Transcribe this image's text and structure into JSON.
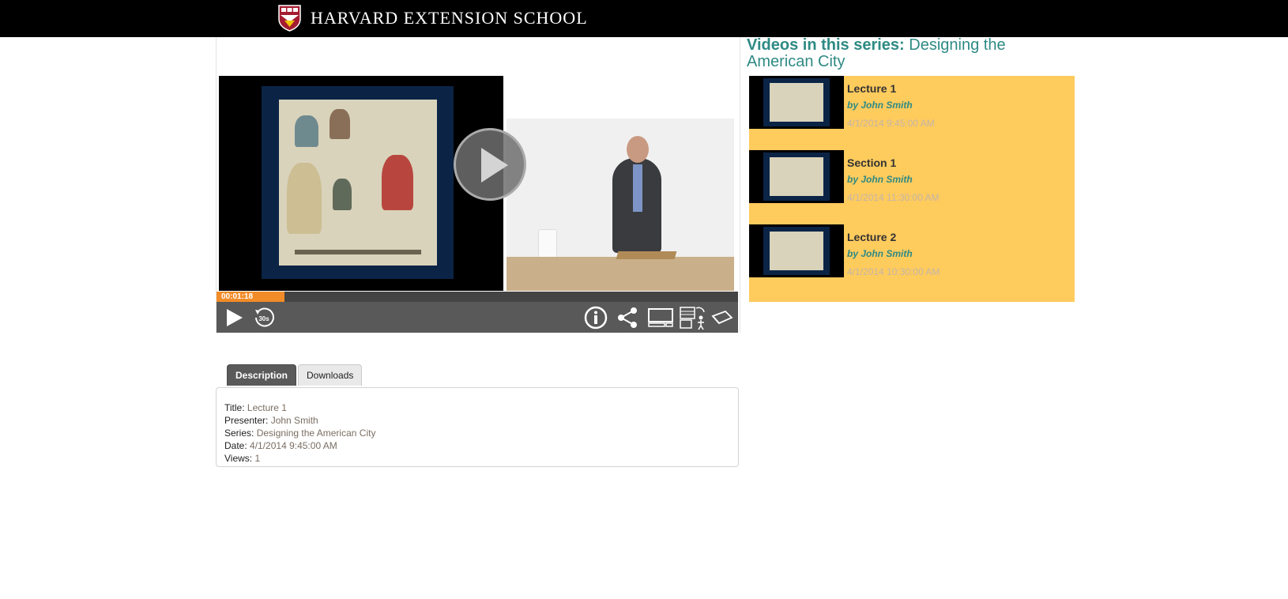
{
  "header": {
    "brand": "HARVARD EXTENSION SCHOOL"
  },
  "player": {
    "current_time": "00:01:18",
    "progress_fraction": 0.13,
    "controls": {
      "play": "play-icon",
      "rewind": "30s",
      "info": "info-icon",
      "share": "share-icon",
      "layout": "layout-icon",
      "swap": "swap-icon",
      "hide": "hide-icon"
    }
  },
  "tabs": [
    {
      "label": "Description",
      "active": true
    },
    {
      "label": "Downloads",
      "active": false
    }
  ],
  "description": {
    "title_label": "Title:",
    "title_value": "Lecture 1",
    "presenter_label": "Presenter:",
    "presenter_value": "John Smith",
    "series_label": "Series:",
    "series_value": "Designing the American City",
    "date_label": "Date:",
    "date_value": "4/1/2014 9:45:00 AM",
    "views_label": "Views:",
    "views_value": "1"
  },
  "series_panel": {
    "heading_prefix": "Videos in this series:",
    "heading_series": "Designing the American City",
    "items": [
      {
        "title": "Lecture 1",
        "by": "by John Smith",
        "date": "4/1/2014 9:45:00 AM"
      },
      {
        "title": "Section 1",
        "by": "by John Smith",
        "date": "4/1/2014 11:30:00 AM"
      },
      {
        "title": "Lecture 2",
        "by": "by John Smith",
        "date": "4/1/2014 10:30:00 AM"
      }
    ]
  },
  "colors": {
    "accent_teal": "#2e8a84",
    "playlist_bg": "#fecb5d",
    "progress": "#f28c28",
    "topbar": "#000000"
  }
}
